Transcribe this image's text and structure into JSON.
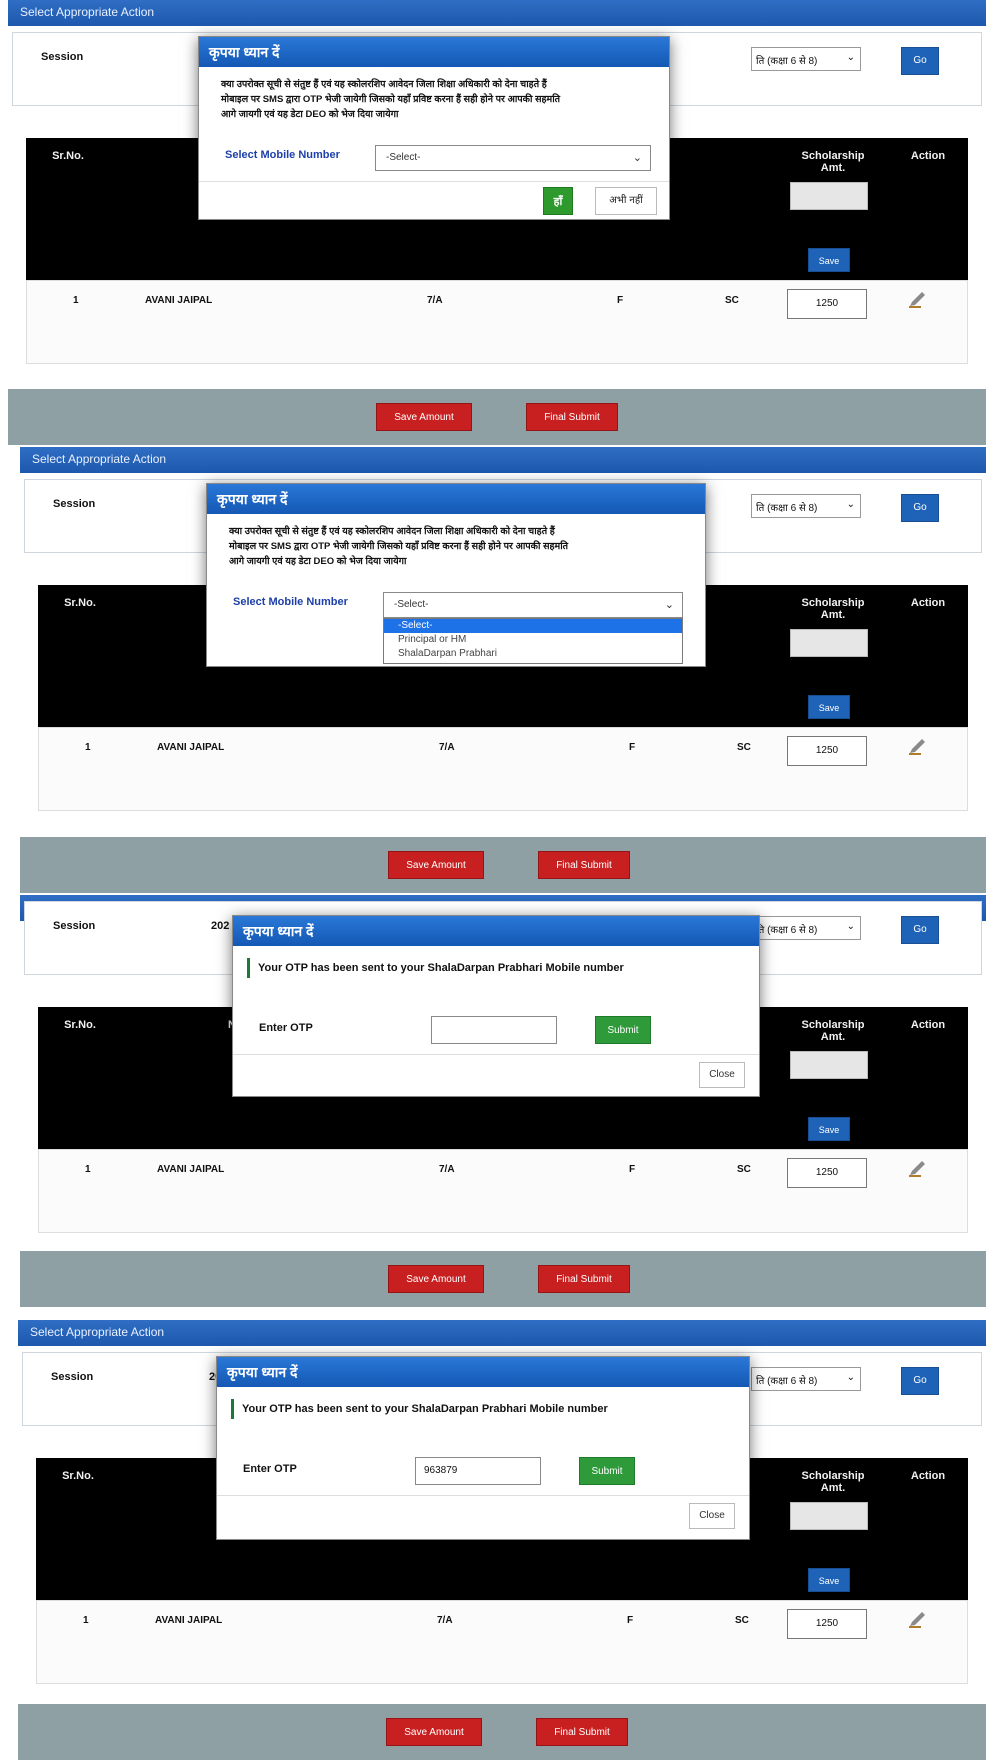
{
  "header": {
    "title": "Select Appropriate Action"
  },
  "session": {
    "label": "Session",
    "value": "202",
    "class_select": "ति (कक्षा 6 से 8)",
    "go_label": "Go"
  },
  "table": {
    "headers": {
      "sr": "Sr.No.",
      "name": "Na",
      "amount": "Scholarship Amt.",
      "action": "Action"
    },
    "save_small": "Save",
    "row": {
      "sr": "1",
      "name": "AVANI JAIPAL",
      "class": "7/A",
      "gender": "F",
      "category": "SC",
      "amount": "1250"
    }
  },
  "footer": {
    "save_amount": "Save Amount",
    "final_submit": "Final Submit"
  },
  "confirm_modal": {
    "title": "कृपया ध्यान दें",
    "message_lines": [
      "क्या उपरोक्त सूची से संतुष्ट हैं एवं यह स्कोलरशिप आवेदन जिला शिक्षा अधिकारी को देना चाहते हैं",
      "मोबाइल पर SMS द्वारा OTP भेजी जायेगी जिसको यहाँ प्रविष्ट करना हैं सही होने पर आपकी सहमति",
      "आगे जायगी एवं यह डेटा DEO को भेज दिया जायेगा"
    ],
    "mobile_label": "Select Mobile Number",
    "mobile_selected": "-Select-",
    "yes_label": "हाँ",
    "no_label": "अभी नहीं",
    "dropdown_options": [
      "-Select-",
      "Principal or HM",
      "ShalaDarpan Prabhari"
    ]
  },
  "otp_modal": {
    "title": "कृपया ध्यान दें",
    "message": "Your OTP has been sent to your ShalaDarpan Prabhari Mobile number",
    "otp_label": "Enter OTP",
    "otp_value_empty": "",
    "otp_value_filled": "963879",
    "submit_label": "Submit",
    "close_label": "Close"
  },
  "colors": {
    "header_blue": "#1d58ad",
    "modal_blue": "#1458b4",
    "red": "#c82020",
    "green": "#2e9a2e"
  }
}
